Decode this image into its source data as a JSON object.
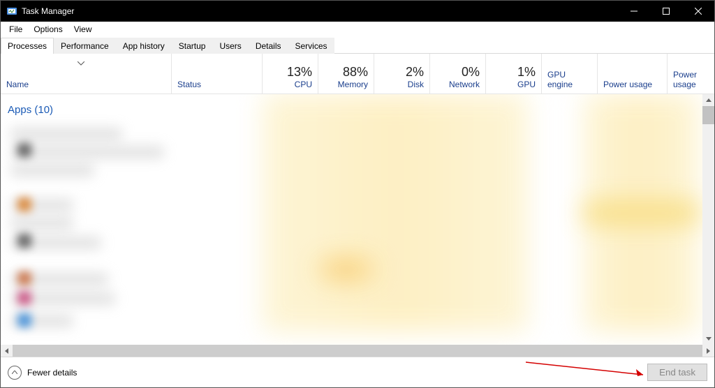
{
  "window": {
    "title": "Task Manager"
  },
  "menu": {
    "file": "File",
    "options": "Options",
    "view": "View"
  },
  "tabs": {
    "processes": "Processes",
    "performance": "Performance",
    "app_history": "App history",
    "startup": "Startup",
    "users": "Users",
    "details": "Details",
    "services": "Services"
  },
  "columns": {
    "name": "Name",
    "status": "Status",
    "cpu": {
      "value": "13%",
      "label": "CPU"
    },
    "memory": {
      "value": "88%",
      "label": "Memory"
    },
    "disk": {
      "value": "2%",
      "label": "Disk"
    },
    "network": {
      "value": "0%",
      "label": "Network"
    },
    "gpu": {
      "value": "1%",
      "label": "GPU"
    },
    "gpu_engine": "GPU engine",
    "power_usage": "Power usage",
    "power_usage_trend": "Power usage"
  },
  "groups": {
    "apps": "Apps (10)"
  },
  "footer": {
    "fewer": "Fewer details",
    "end_task": "End task"
  }
}
